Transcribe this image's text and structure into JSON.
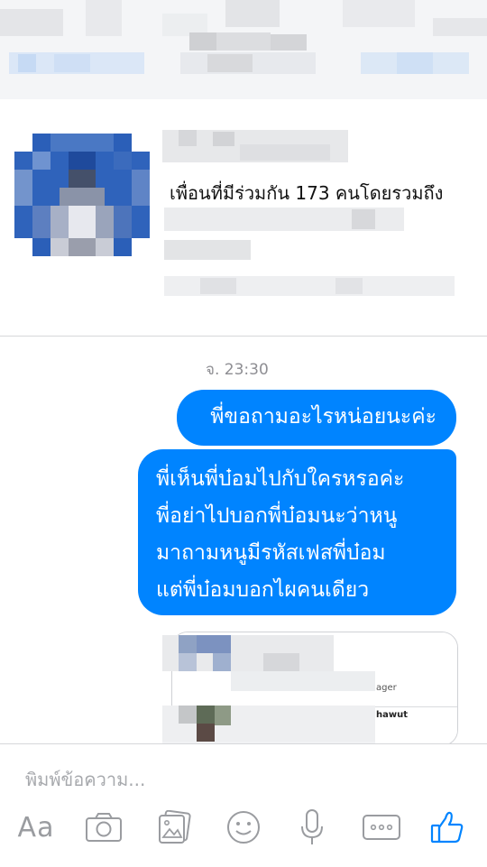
{
  "profile": {
    "mutual_friends_text": "เพื่อนที่มีร่วมกัน 173 คนโดยรวมถึง"
  },
  "conversation": {
    "timestamp": "จ. 23:30",
    "messages": [
      {
        "lines": [
          "พี่ขอถามอะไรหน่อยนะค่ะ"
        ]
      },
      {
        "lines": [
          "พี่เห็นพี่บ๋อมไปกับใครหรอค่ะ",
          "พี่อย่าไปบอกพี่บ๋อมนะว่าหนู",
          "มาถามหนูมีรหัสเฟสพี่บ๋อม",
          "แต่พี่บ๋อมบอกไผคนเดียว"
        ]
      }
    ],
    "attachment": {
      "fragment_1": "ager",
      "fragment_2": "hawut"
    }
  },
  "composer": {
    "placeholder": "พิมพ์ข้อความ...",
    "aa_label": "Aa"
  },
  "toolbar": {
    "icons": [
      "aa-text-icon",
      "camera-icon",
      "gallery-icon",
      "emoji-icon",
      "microphone-icon",
      "more-icon",
      "thumbs-up-icon"
    ]
  },
  "colors": {
    "bubble": "#0084ff",
    "like": "#0084ff",
    "tool_gray": "#9a9ca0",
    "divider": "#d6d7da"
  }
}
